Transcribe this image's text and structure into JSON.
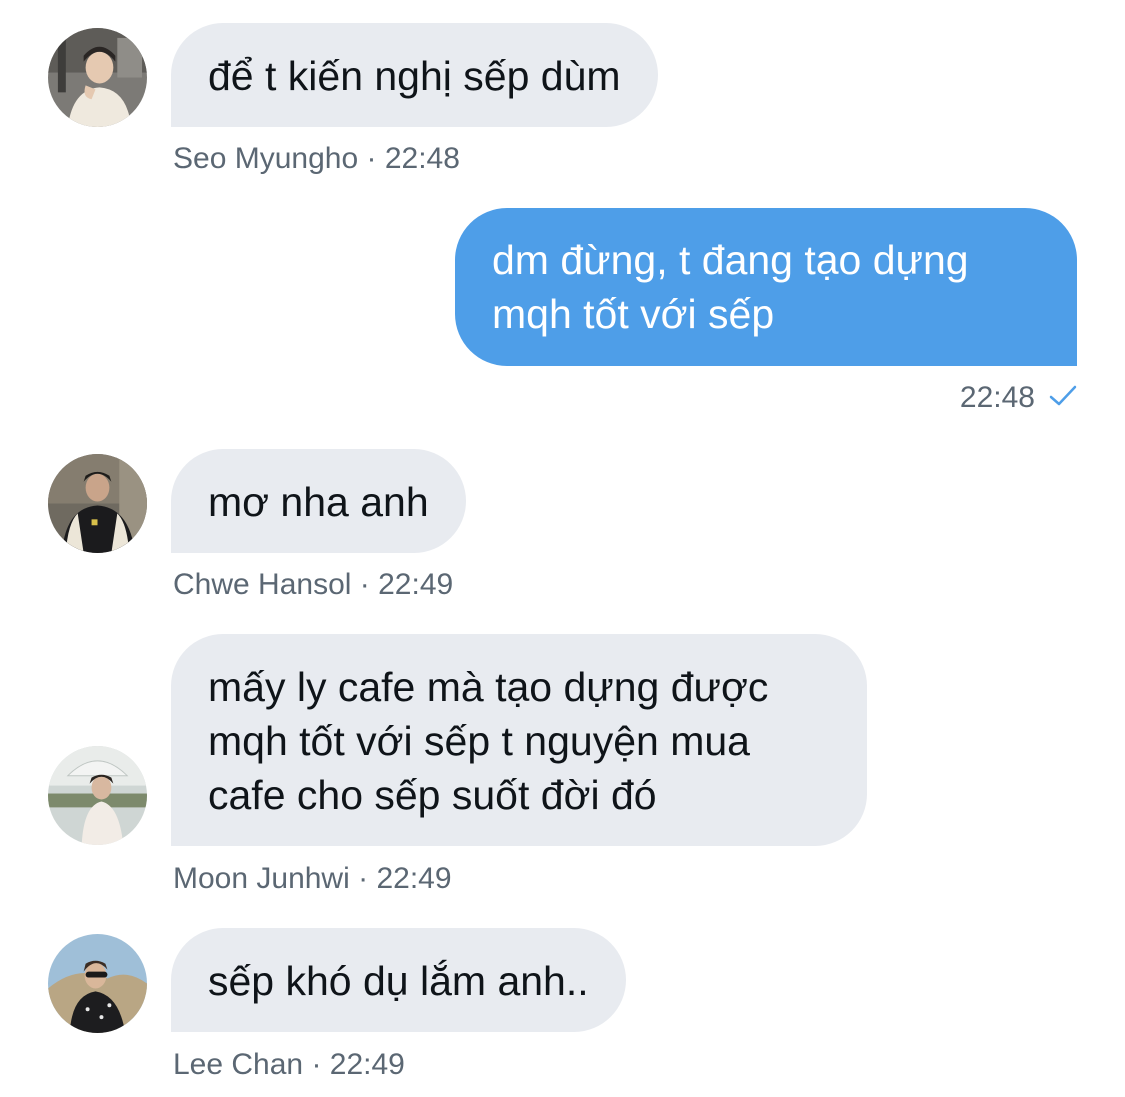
{
  "messages": [
    {
      "sender": "Seo Myungho",
      "time": "22:48",
      "text": "để t kiến nghị sếp dùm",
      "separator": "·"
    },
    {
      "sender": "",
      "time": "22:48",
      "text": "dm đừng, t đang tạo dựng\nmqh tốt với sếp",
      "outgoing": true,
      "status_icon": "check-icon"
    },
    {
      "sender": "Chwe Hansol",
      "time": "22:49",
      "text": "mơ nha anh",
      "separator": "·"
    },
    {
      "sender": "Moon Junhwi",
      "time": "22:49",
      "text": "mấy ly cafe mà tạo dựng được\nmqh tốt với sếp t nguyện mua\ncafe cho sếp suốt đời đó",
      "separator": "·"
    },
    {
      "sender": "Lee Chan",
      "time": "22:49",
      "text": "sếp khó dụ lắm anh..",
      "separator": "·"
    }
  ],
  "colors": {
    "incoming_bubble": "#e8ebf0",
    "outgoing_bubble": "#4e9ee8",
    "meta_text": "#5b6773",
    "check": "#4e9ee8"
  }
}
